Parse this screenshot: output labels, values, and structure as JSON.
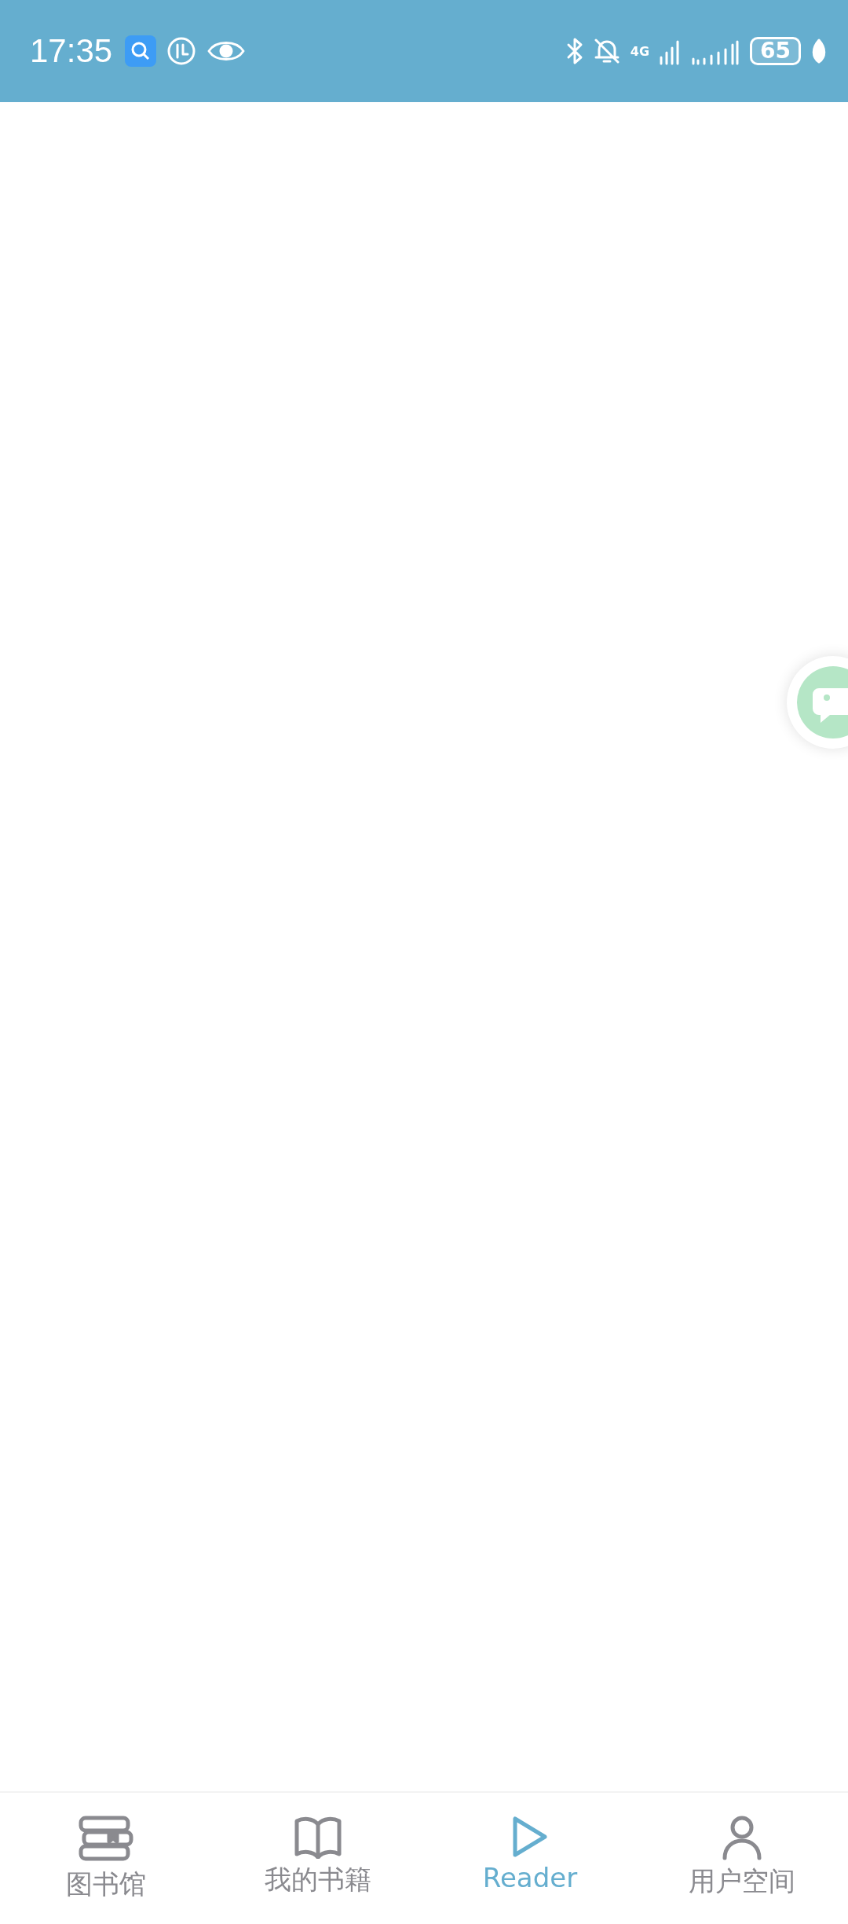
{
  "status_bar": {
    "time": "17:35",
    "network": "4G",
    "battery": "65"
  },
  "floating_button": {
    "kind": "chat"
  },
  "tabs": [
    {
      "label": "图书馆",
      "kind": "books",
      "selected": false
    },
    {
      "label": "我的书籍",
      "kind": "book",
      "selected": false
    },
    {
      "label": "Reader",
      "kind": "play",
      "selected": true
    },
    {
      "label": "用户空间",
      "kind": "user",
      "selected": false
    }
  ]
}
